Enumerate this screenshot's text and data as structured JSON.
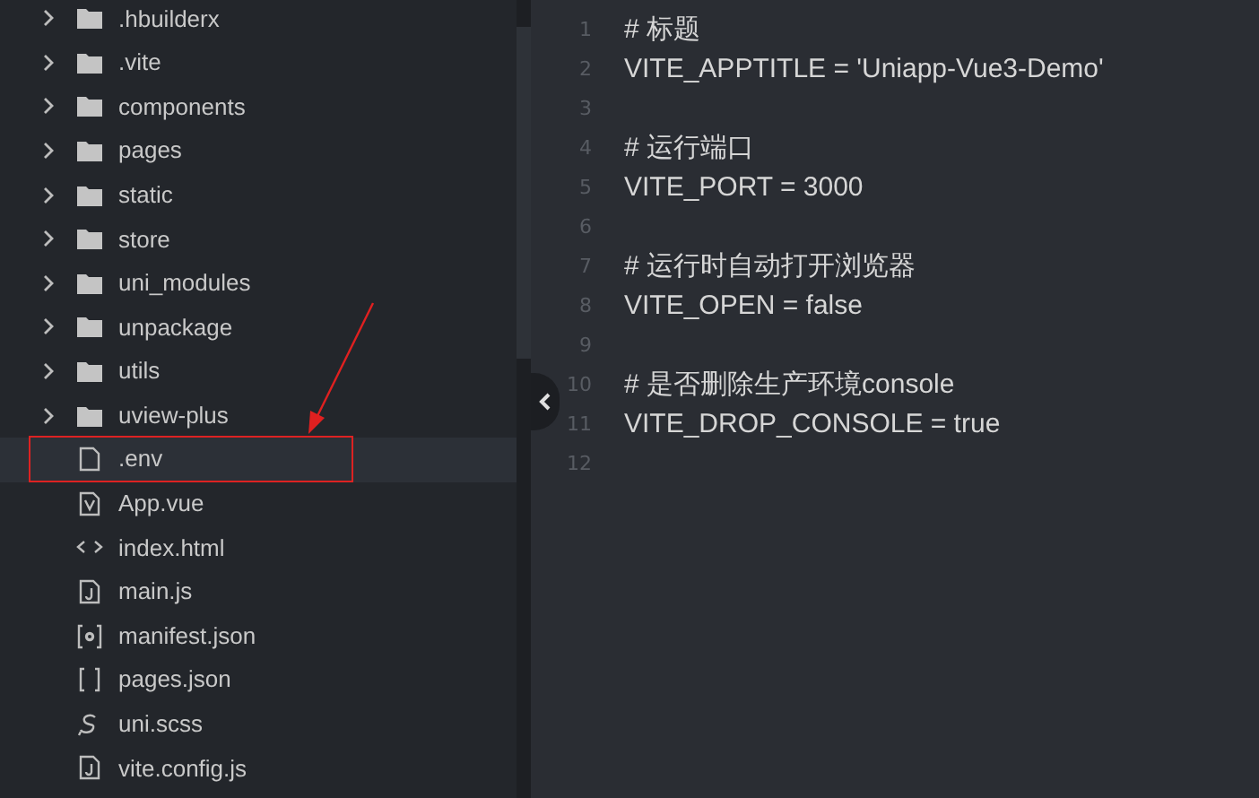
{
  "file_tree": [
    {
      "label": ".hbuilderx",
      "kind": "folder",
      "expanded": false,
      "selected": false,
      "annotated": false
    },
    {
      "label": ".vite",
      "kind": "folder",
      "expanded": false,
      "selected": false,
      "annotated": false
    },
    {
      "label": "components",
      "kind": "folder",
      "expanded": false,
      "selected": false,
      "annotated": false
    },
    {
      "label": "pages",
      "kind": "folder",
      "expanded": false,
      "selected": false,
      "annotated": false
    },
    {
      "label": "static",
      "kind": "folder",
      "expanded": false,
      "selected": false,
      "annotated": false
    },
    {
      "label": "store",
      "kind": "folder",
      "expanded": false,
      "selected": false,
      "annotated": false
    },
    {
      "label": "uni_modules",
      "kind": "folder",
      "expanded": false,
      "selected": false,
      "annotated": false
    },
    {
      "label": "unpackage",
      "kind": "folder",
      "expanded": false,
      "selected": false,
      "annotated": false
    },
    {
      "label": "utils",
      "kind": "folder",
      "expanded": false,
      "selected": false,
      "annotated": false
    },
    {
      "label": "uview-plus",
      "kind": "folder",
      "expanded": false,
      "selected": false,
      "annotated": false
    },
    {
      "label": ".env",
      "kind": "plain",
      "selected": true,
      "annotated": true
    },
    {
      "label": "App.vue",
      "kind": "vue",
      "selected": false,
      "annotated": false
    },
    {
      "label": "index.html",
      "kind": "markup",
      "selected": false,
      "annotated": false
    },
    {
      "label": "main.js",
      "kind": "script",
      "selected": false,
      "annotated": false
    },
    {
      "label": "manifest.json",
      "kind": "config",
      "selected": false,
      "annotated": false
    },
    {
      "label": "pages.json",
      "kind": "json",
      "selected": false,
      "annotated": false
    },
    {
      "label": "uni.scss",
      "kind": "style",
      "selected": false,
      "annotated": false
    },
    {
      "label": "vite.config.js",
      "kind": "script",
      "selected": false,
      "annotated": false
    }
  ],
  "editor": {
    "lines": [
      {
        "number": "1",
        "text": "# 标题"
      },
      {
        "number": "2",
        "text": "VITE_APPTITLE = 'Uniapp-Vue3-Demo'"
      },
      {
        "number": "3"
      },
      {
        "number": "4",
        "text": "# 运行端口"
      },
      {
        "number": "5",
        "text": "VITE_PORT = 3000"
      },
      {
        "number": "6"
      },
      {
        "number": "7",
        "text": "# 运行时自动打开浏览器"
      },
      {
        "number": "8",
        "text": "VITE_OPEN = false"
      },
      {
        "number": "9"
      },
      {
        "number": "10",
        "text": "# 是否删除生产环境console"
      },
      {
        "number": "11",
        "text": "VITE_DROP_CONSOLE = true"
      },
      {
        "number": "12"
      }
    ]
  }
}
